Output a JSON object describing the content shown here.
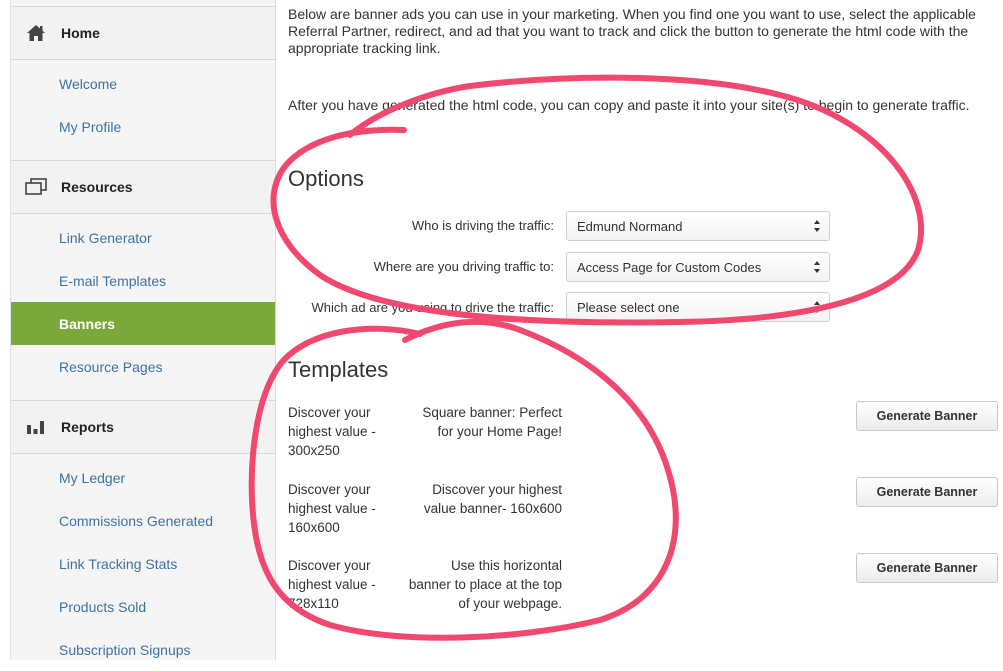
{
  "sidebar": {
    "sections": [
      {
        "title": "Home",
        "icon": "home-icon",
        "items": [
          "Welcome",
          "My Profile"
        ]
      },
      {
        "title": "Resources",
        "icon": "resources-icon",
        "items": [
          "Link Generator",
          "E-mail Templates",
          "Banners",
          "Resource Pages"
        ]
      },
      {
        "title": "Reports",
        "icon": "bar-chart-icon",
        "items": [
          "My Ledger",
          "Commissions Generated",
          "Link Tracking Stats",
          "Products Sold",
          "Subscription Signups"
        ]
      }
    ],
    "active_item": "Banners",
    "active_color": "#7aa83a",
    "link_color": "#3d72a4"
  },
  "main": {
    "intro_p1": "Below are banner ads you can use in your marketing. When you find one you want to use, select the applicable Referral Partner, redirect, and ad that you want to track and click the button to generate the html code with the appropriate tracking link.",
    "intro_p2": "After you have generated the html code, you can copy and paste it into your site(s) to begin to generate traffic.",
    "options": {
      "title": "Options",
      "fields": [
        {
          "label": "Who is driving the traffic:",
          "value": "Edmund Normand"
        },
        {
          "label": "Where are you driving traffic to:",
          "value": "Access Page for Custom Codes"
        },
        {
          "label": "Which ad are you using to drive the traffic:",
          "value": "Please select one"
        }
      ]
    },
    "templates": {
      "title": "Templates",
      "button_label": "Generate Banner",
      "rows": [
        {
          "name": "Discover your highest value - 300x250",
          "desc": "Square banner: Perfect for your Home Page!"
        },
        {
          "name": "Discover your highest value - 160x600",
          "desc": "Discover your highest value banner- 160x600"
        },
        {
          "name": "Discover your highest value - 728x110",
          "desc": "Use this horizontal banner to place at the top of your webpage."
        }
      ]
    }
  },
  "annotation_color": "#f0486e"
}
